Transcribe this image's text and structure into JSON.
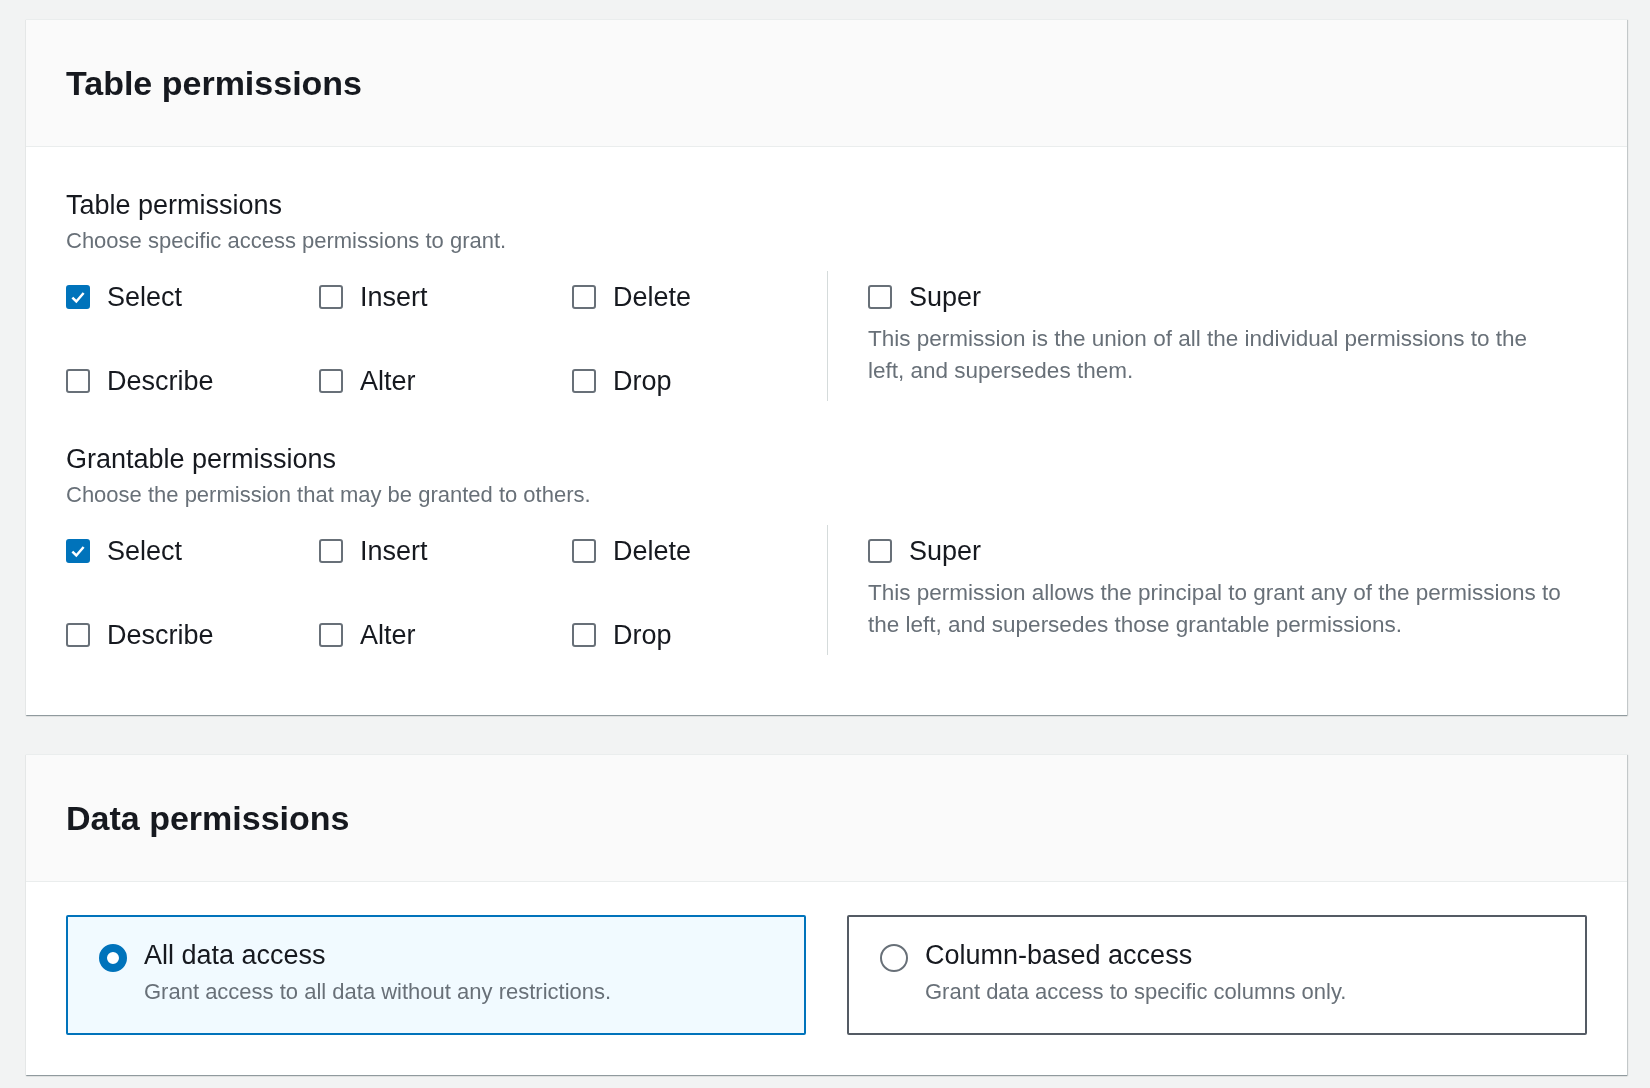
{
  "sections": [
    {
      "title": "Table permissions",
      "kind": "checkbox-groups",
      "groups": [
        {
          "label": "Table permissions",
          "description": "Choose specific access permissions to grant.",
          "options": [
            {
              "label": "Select",
              "checked": true
            },
            {
              "label": "Insert",
              "checked": false
            },
            {
              "label": "Delete",
              "checked": false
            },
            {
              "label": "Describe",
              "checked": false
            },
            {
              "label": "Alter",
              "checked": false
            },
            {
              "label": "Drop",
              "checked": false
            }
          ],
          "super": {
            "label": "Super",
            "checked": false,
            "description": "This permission is the union of all the individual permissions to the left, and supersedes them."
          }
        },
        {
          "label": "Grantable permissions",
          "description": "Choose the permission that may be granted to others.",
          "options": [
            {
              "label": "Select",
              "checked": true
            },
            {
              "label": "Insert",
              "checked": false
            },
            {
              "label": "Delete",
              "checked": false
            },
            {
              "label": "Describe",
              "checked": false
            },
            {
              "label": "Alter",
              "checked": false
            },
            {
              "label": "Drop",
              "checked": false
            }
          ],
          "super": {
            "label": "Super",
            "checked": false,
            "description": "This permission allows the principal to grant any of the permissions to the left, and supersedes those grantable permissions."
          }
        }
      ]
    },
    {
      "title": "Data permissions",
      "kind": "radio-cards",
      "options": [
        {
          "label": "All data access",
          "description": "Grant access to all data without any restrictions.",
          "selected": true
        },
        {
          "label": "Column-based access",
          "description": "Grant data access to specific columns only.",
          "selected": false
        }
      ]
    }
  ]
}
